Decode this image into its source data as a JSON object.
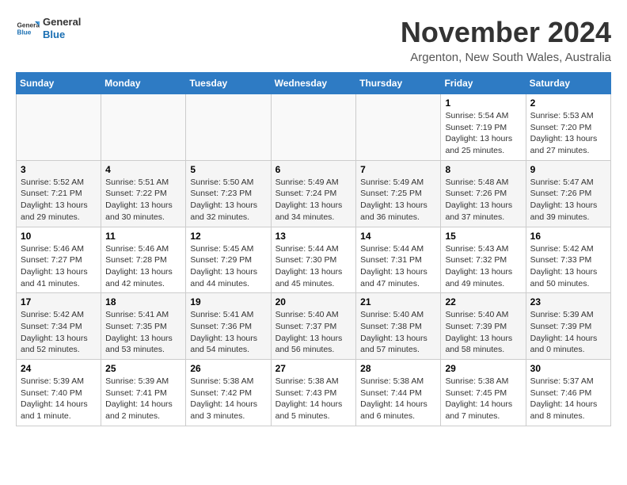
{
  "header": {
    "logo_general": "General",
    "logo_blue": "Blue",
    "month_title": "November 2024",
    "location": "Argenton, New South Wales, Australia"
  },
  "calendar": {
    "headers": [
      "Sunday",
      "Monday",
      "Tuesday",
      "Wednesday",
      "Thursday",
      "Friday",
      "Saturday"
    ],
    "weeks": [
      [
        {
          "day": "",
          "info": ""
        },
        {
          "day": "",
          "info": ""
        },
        {
          "day": "",
          "info": ""
        },
        {
          "day": "",
          "info": ""
        },
        {
          "day": "",
          "info": ""
        },
        {
          "day": "1",
          "info": "Sunrise: 5:54 AM\nSunset: 7:19 PM\nDaylight: 13 hours\nand 25 minutes."
        },
        {
          "day": "2",
          "info": "Sunrise: 5:53 AM\nSunset: 7:20 PM\nDaylight: 13 hours\nand 27 minutes."
        }
      ],
      [
        {
          "day": "3",
          "info": "Sunrise: 5:52 AM\nSunset: 7:21 PM\nDaylight: 13 hours\nand 29 minutes."
        },
        {
          "day": "4",
          "info": "Sunrise: 5:51 AM\nSunset: 7:22 PM\nDaylight: 13 hours\nand 30 minutes."
        },
        {
          "day": "5",
          "info": "Sunrise: 5:50 AM\nSunset: 7:23 PM\nDaylight: 13 hours\nand 32 minutes."
        },
        {
          "day": "6",
          "info": "Sunrise: 5:49 AM\nSunset: 7:24 PM\nDaylight: 13 hours\nand 34 minutes."
        },
        {
          "day": "7",
          "info": "Sunrise: 5:49 AM\nSunset: 7:25 PM\nDaylight: 13 hours\nand 36 minutes."
        },
        {
          "day": "8",
          "info": "Sunrise: 5:48 AM\nSunset: 7:26 PM\nDaylight: 13 hours\nand 37 minutes."
        },
        {
          "day": "9",
          "info": "Sunrise: 5:47 AM\nSunset: 7:26 PM\nDaylight: 13 hours\nand 39 minutes."
        }
      ],
      [
        {
          "day": "10",
          "info": "Sunrise: 5:46 AM\nSunset: 7:27 PM\nDaylight: 13 hours\nand 41 minutes."
        },
        {
          "day": "11",
          "info": "Sunrise: 5:46 AM\nSunset: 7:28 PM\nDaylight: 13 hours\nand 42 minutes."
        },
        {
          "day": "12",
          "info": "Sunrise: 5:45 AM\nSunset: 7:29 PM\nDaylight: 13 hours\nand 44 minutes."
        },
        {
          "day": "13",
          "info": "Sunrise: 5:44 AM\nSunset: 7:30 PM\nDaylight: 13 hours\nand 45 minutes."
        },
        {
          "day": "14",
          "info": "Sunrise: 5:44 AM\nSunset: 7:31 PM\nDaylight: 13 hours\nand 47 minutes."
        },
        {
          "day": "15",
          "info": "Sunrise: 5:43 AM\nSunset: 7:32 PM\nDaylight: 13 hours\nand 49 minutes."
        },
        {
          "day": "16",
          "info": "Sunrise: 5:42 AM\nSunset: 7:33 PM\nDaylight: 13 hours\nand 50 minutes."
        }
      ],
      [
        {
          "day": "17",
          "info": "Sunrise: 5:42 AM\nSunset: 7:34 PM\nDaylight: 13 hours\nand 52 minutes."
        },
        {
          "day": "18",
          "info": "Sunrise: 5:41 AM\nSunset: 7:35 PM\nDaylight: 13 hours\nand 53 minutes."
        },
        {
          "day": "19",
          "info": "Sunrise: 5:41 AM\nSunset: 7:36 PM\nDaylight: 13 hours\nand 54 minutes."
        },
        {
          "day": "20",
          "info": "Sunrise: 5:40 AM\nSunset: 7:37 PM\nDaylight: 13 hours\nand 56 minutes."
        },
        {
          "day": "21",
          "info": "Sunrise: 5:40 AM\nSunset: 7:38 PM\nDaylight: 13 hours\nand 57 minutes."
        },
        {
          "day": "22",
          "info": "Sunrise: 5:40 AM\nSunset: 7:39 PM\nDaylight: 13 hours\nand 58 minutes."
        },
        {
          "day": "23",
          "info": "Sunrise: 5:39 AM\nSunset: 7:39 PM\nDaylight: 14 hours\nand 0 minutes."
        }
      ],
      [
        {
          "day": "24",
          "info": "Sunrise: 5:39 AM\nSunset: 7:40 PM\nDaylight: 14 hours\nand 1 minute."
        },
        {
          "day": "25",
          "info": "Sunrise: 5:39 AM\nSunset: 7:41 PM\nDaylight: 14 hours\nand 2 minutes."
        },
        {
          "day": "26",
          "info": "Sunrise: 5:38 AM\nSunset: 7:42 PM\nDaylight: 14 hours\nand 3 minutes."
        },
        {
          "day": "27",
          "info": "Sunrise: 5:38 AM\nSunset: 7:43 PM\nDaylight: 14 hours\nand 5 minutes."
        },
        {
          "day": "28",
          "info": "Sunrise: 5:38 AM\nSunset: 7:44 PM\nDaylight: 14 hours\nand 6 minutes."
        },
        {
          "day": "29",
          "info": "Sunrise: 5:38 AM\nSunset: 7:45 PM\nDaylight: 14 hours\nand 7 minutes."
        },
        {
          "day": "30",
          "info": "Sunrise: 5:37 AM\nSunset: 7:46 PM\nDaylight: 14 hours\nand 8 minutes."
        }
      ]
    ]
  }
}
